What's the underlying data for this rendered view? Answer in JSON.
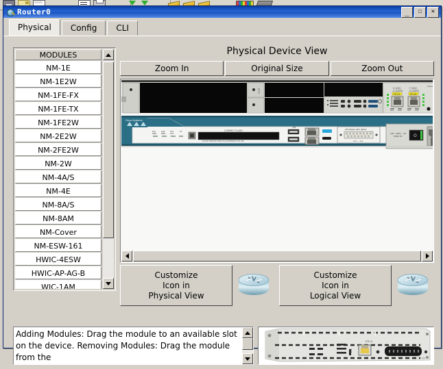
{
  "app_toolbar": {
    "icons": [
      "save-icon",
      "open-folder-icon",
      "new-page-icon",
      "list-icon",
      "print-icon",
      "import-arrow-icon",
      "export-arrow-icon",
      "note-flag-icon",
      "note-flag-icon-2",
      "note-flag-icon-3",
      "color-palette-icon",
      "device-icon"
    ]
  },
  "window": {
    "title": "Router0",
    "icon": "router-magnifier-icon",
    "buttons": {
      "minimize": "_",
      "maximize": "☐",
      "close": "✕"
    }
  },
  "tabs": [
    {
      "label": "Physical",
      "active": true
    },
    {
      "label": "Config",
      "active": false
    },
    {
      "label": "CLI",
      "active": false
    }
  ],
  "modules": {
    "header": "MODULES",
    "items": [
      "NM-1E",
      "NM-1E2W",
      "NM-1FE-FX",
      "NM-1FE-TX",
      "NM-1FE2W",
      "NM-2E2W",
      "NM-2FE2W",
      "NM-2W",
      "NM-4A/S",
      "NM-4E",
      "NM-8A/S",
      "NM-8AM",
      "NM-Cover",
      "NM-ESW-161",
      "HWIC-4ESW",
      "HWIC-AP-AG-B",
      "WIC-1AM"
    ]
  },
  "device_view": {
    "title": "Physical Device View",
    "zoom_buttons": [
      "Zoom In",
      "Original Size",
      "Zoom Out"
    ],
    "chassis": {
      "brand": "Cisco Systems",
      "led_labels": [
        "SYS PWR",
        "AUX PWR",
        "SYS ACT",
        "CF"
      ],
      "compact_flash_label": "COMPACT FLASH",
      "rps_label": "OPTIONAL RPS INPUT",
      "rps_sub": "12V  —  11a",
      "psu_label": "100 - 240V ~ 2A 50/60 Hz",
      "port_labels_left": [
        "GE 0/0",
        "GE 0/1"
      ],
      "badge_left": "FE 0/1",
      "badge_right": "FE 0/0",
      "nic_footer": [
        "SPD",
        "LINK",
        "SPD",
        "LINK"
      ]
    }
  },
  "customize": {
    "physical": {
      "line1": "Customize",
      "line2": "Icon in",
      "line3": "Physical View",
      "icon": "router-3d-icon"
    },
    "logical": {
      "line1": "Customize",
      "line2": "Icon in",
      "line3": "Logical View",
      "icon": "router-3d-icon"
    }
  },
  "info": {
    "text": "Adding Modules: Drag the module to an available slot on the device.\nRemoving Modules: Drag the module from the"
  },
  "module_preview": {
    "name": "nm-1e-module-image",
    "port_label": "ETH 0"
  },
  "colors": {
    "cisco_teal": "#2b6f86",
    "window_face": "#d4d0c8",
    "title_blue": "#1a51bd",
    "active_tab": "#ecebe6",
    "led_green": "#39c23b",
    "badge_yellow": "#f2e52a"
  }
}
